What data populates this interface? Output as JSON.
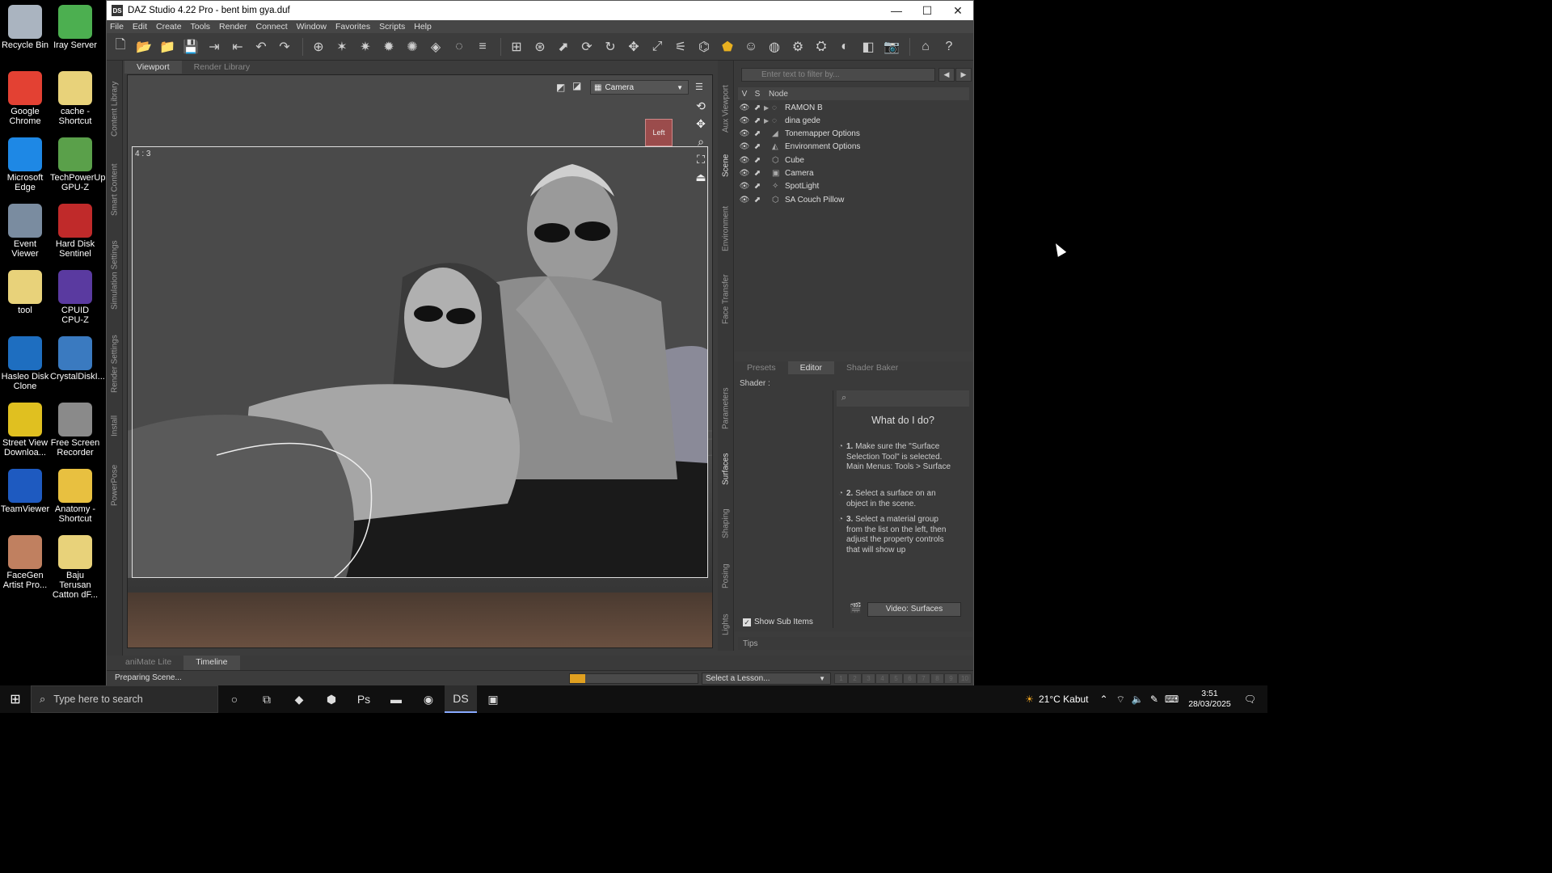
{
  "desktop_icons": [
    {
      "label": "Recycle Bin",
      "color": "#aab4c0"
    },
    {
      "label": "Iray Server",
      "color": "#4caf50"
    },
    {
      "label": "Google Chrome",
      "color": "#e34133"
    },
    {
      "label": "cache - Shortcut",
      "color": "#e8d27a"
    },
    {
      "label": "Microsoft Edge",
      "color": "#1e88e5"
    },
    {
      "label": "TechPowerUp GPU-Z",
      "color": "#5aa04a"
    },
    {
      "label": "Event Viewer",
      "color": "#7a8ca0"
    },
    {
      "label": "Hard Disk Sentinel",
      "color": "#c02a2a"
    },
    {
      "label": "tool",
      "color": "#e8d27a"
    },
    {
      "label": "CPUID CPU-Z",
      "color": "#5a3aa0"
    },
    {
      "label": "Hasleo Disk Clone",
      "color": "#1e6ec0"
    },
    {
      "label": "CrystalDiskI...",
      "color": "#3a7ac0"
    },
    {
      "label": "Street View Downloa...",
      "color": "#e0c020"
    },
    {
      "label": "Free Screen Recorder",
      "color": "#8a8a8a"
    },
    {
      "label": "TeamViewer",
      "color": "#1e5ac0"
    },
    {
      "label": "Anatomy - Shortcut",
      "color": "#e8c040"
    },
    {
      "label": "FaceGen Artist Pro...",
      "color": "#c08060"
    },
    {
      "label": "Baju Terusan Catton dF...",
      "color": "#e8d27a"
    }
  ],
  "window": {
    "title": "DAZ Studio 4.22 Pro - bent bim gya.duf",
    "app_icon": "DS",
    "minimize": "—",
    "maximize": "☐",
    "close": "✕"
  },
  "menu": [
    "File",
    "Edit",
    "Create",
    "Tools",
    "Render",
    "Connect",
    "Window",
    "Favorites",
    "Scripts",
    "Help"
  ],
  "left_tabs": [
    "Content Library",
    "Smart Content",
    "Simulation Settings",
    "Render Settings",
    "Install",
    "PowerPose"
  ],
  "viewport_tabs": [
    {
      "label": "Viewport",
      "active": true
    },
    {
      "label": "Render Library",
      "active": false
    }
  ],
  "viewport": {
    "aspect_label": "4 : 3",
    "camera_select": "Camera",
    "view_cube_label": "Left"
  },
  "side_tabs_right": [
    "Aux Viewport",
    "Scene",
    "Environment",
    "Face Transfer",
    "Parameters",
    "Surfaces",
    "Shaping",
    "Posing",
    "Lights"
  ],
  "scene": {
    "filter_placeholder": "Enter text to filter by...",
    "col_v": "V",
    "col_s": "S",
    "col_node": "Node",
    "nodes": [
      {
        "name": "RAMON B",
        "icon": "figure-icon",
        "expand": "▶"
      },
      {
        "name": "dina gede",
        "icon": "figure-icon",
        "expand": "▶"
      },
      {
        "name": "Tonemapper Options",
        "icon": "tonemapper-icon",
        "expand": ""
      },
      {
        "name": "Environment Options",
        "icon": "environment-icon",
        "expand": ""
      },
      {
        "name": "Cube",
        "icon": "cube-icon",
        "expand": ""
      },
      {
        "name": "Camera",
        "icon": "camera-icon",
        "expand": ""
      },
      {
        "name": "SpotLight",
        "icon": "spotlight-icon",
        "expand": ""
      },
      {
        "name": "SA Couch Pillow",
        "icon": "prop-icon",
        "expand": ""
      }
    ]
  },
  "editor": {
    "tabs": [
      {
        "label": "Presets",
        "active": false
      },
      {
        "label": "Editor",
        "active": true
      },
      {
        "label": "Shader Baker",
        "active": false
      }
    ],
    "shader_label": "Shader :",
    "help_title": "What do I do?",
    "steps": [
      {
        "num": "1.",
        "text": "Make sure the \"Surface Selection Tool\" is selected. Main Menus: Tools > Surface"
      },
      {
        "num": "2.",
        "text": "Select a surface on an object in the scene."
      },
      {
        "num": "3.",
        "text": "Select a material group from the list on the left, then adjust the property controls that will show up"
      }
    ],
    "video_button": "Video: Surfaces",
    "show_sub_items": "Show Sub Items",
    "show_sub_checked": true,
    "tips_tab": "Tips"
  },
  "bottom_tabs": [
    {
      "label": "aniMate Lite",
      "active": false
    },
    {
      "label": "Timeline",
      "active": true
    }
  ],
  "status": {
    "text": "Preparing Scene...",
    "progress": 0.12,
    "lesson_placeholder": "Select a Lesson...",
    "pager": [
      "1",
      "2",
      "3",
      "4",
      "5",
      "6",
      "7",
      "8",
      "9",
      "10"
    ]
  },
  "taskbar": {
    "search_placeholder": "Type here to search",
    "apps": [
      {
        "name": "cortana-icon",
        "glyph": "○"
      },
      {
        "name": "task-view-icon",
        "glyph": "⧉"
      },
      {
        "name": "app-purple-icon",
        "glyph": "◆"
      },
      {
        "name": "iray-icon",
        "glyph": "⬢"
      },
      {
        "name": "photoshop-icon",
        "glyph": "Ps"
      },
      {
        "name": "file-explorer-icon",
        "glyph": "▬"
      },
      {
        "name": "chrome-icon",
        "glyph": "◉"
      },
      {
        "name": "daz-studio-icon",
        "glyph": "DS"
      },
      {
        "name": "app-generic-icon",
        "glyph": "▣"
      }
    ],
    "weather": "21°C  Kabut",
    "time": "3:51",
    "date": "28/03/2025"
  }
}
